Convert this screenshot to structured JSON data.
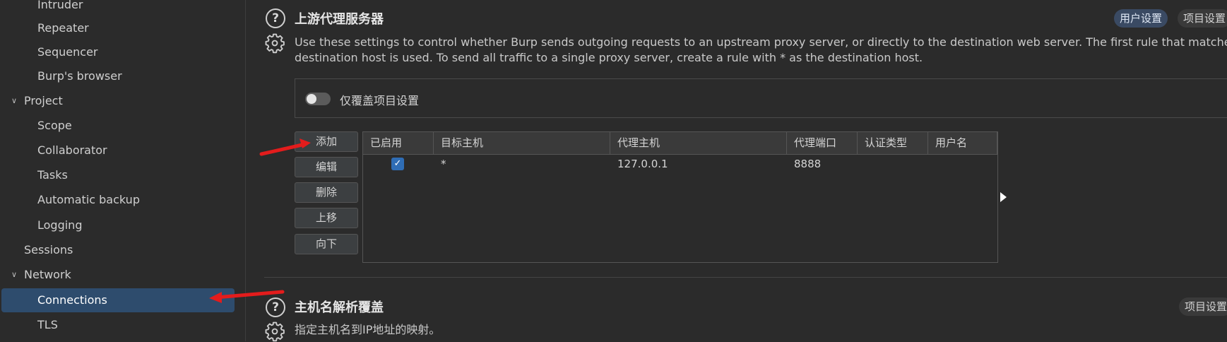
{
  "sidebar": {
    "items": [
      {
        "label": "Intruder"
      },
      {
        "label": "Repeater"
      },
      {
        "label": "Sequencer"
      },
      {
        "label": "Burp's browser"
      },
      {
        "label": "Project"
      },
      {
        "label": "Scope"
      },
      {
        "label": "Collaborator"
      },
      {
        "label": "Tasks"
      },
      {
        "label": "Automatic backup"
      },
      {
        "label": "Logging"
      },
      {
        "label": "Sessions"
      },
      {
        "label": "Network"
      },
      {
        "label": "Connections"
      },
      {
        "label": "TLS"
      }
    ]
  },
  "upstream": {
    "title": "上游代理服务器",
    "description_line1": "Use these settings to control whether Burp sends outgoing requests to an upstream proxy server, or directly to the destination web server. The first rule that matches each",
    "description_line2": "destination host is used. To send all traffic to a single proxy server, create a rule with * as the destination host.",
    "user_settings_pill": "用户设置",
    "project_settings_pill": "项目设置",
    "override_label": "仅覆盖项目设置",
    "override_enabled": false,
    "buttons": {
      "add": "添加",
      "edit": "编辑",
      "remove": "删除",
      "up": "上移",
      "down": "向下"
    },
    "table": {
      "columns": [
        "已启用",
        "目标主机",
        "代理主机",
        "代理端口",
        "认证类型",
        "用户名"
      ],
      "rows": [
        {
          "enabled": true,
          "destination_host": "*",
          "proxy_host": "127.0.0.1",
          "proxy_port": "8888",
          "auth_type": "",
          "username": ""
        }
      ]
    }
  },
  "hostname": {
    "title": "主机名解析覆盖",
    "description": "指定主机名到IP地址的映射。",
    "project_settings_pill": "项目设置"
  },
  "icons": {
    "help": "question-circle-icon",
    "settings": "gear-icon",
    "expand": "chevron-down-icon",
    "checkbox": "checkmark-icon",
    "annotation": "red-arrow-icon"
  },
  "colors": {
    "active_item": "#2e4c6d",
    "checkbox": "#2f6db5",
    "annotation_arrow": "#e31c1c"
  }
}
